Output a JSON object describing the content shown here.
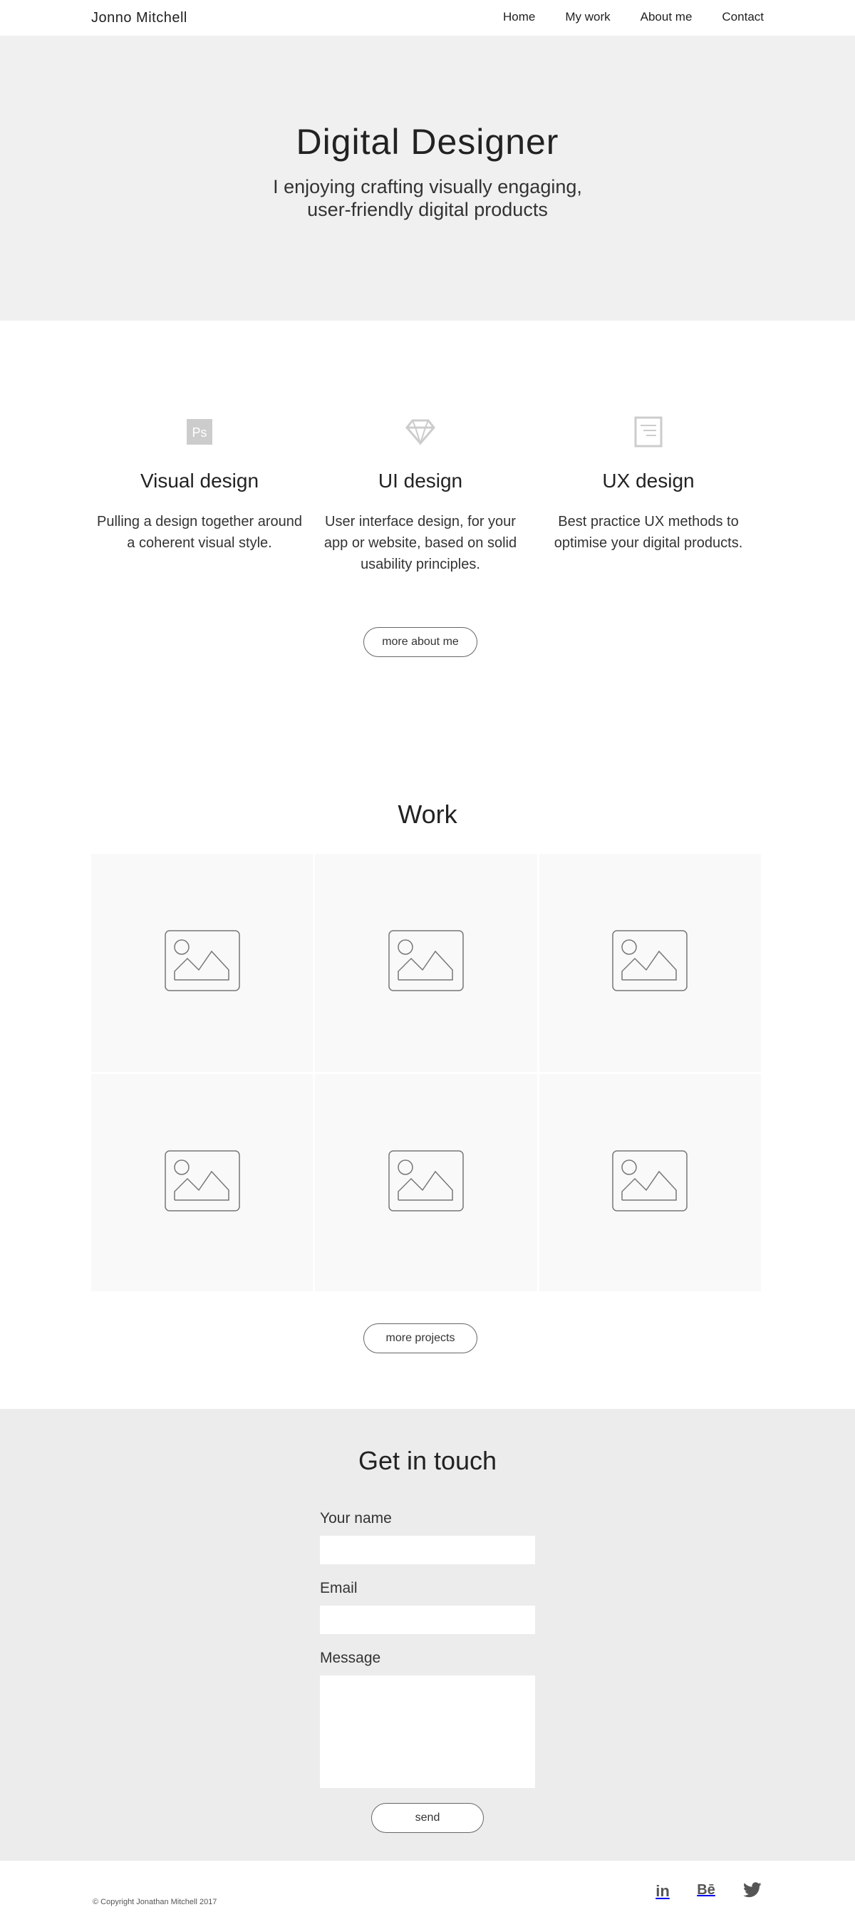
{
  "header": {
    "brand": "Jonno Mitchell",
    "nav": [
      "Home",
      "My work",
      "About me",
      "Contact"
    ]
  },
  "hero": {
    "title": "Digital Designer",
    "subtitle": "I enjoying crafting visually engaging, user-friendly digital products"
  },
  "services": {
    "items": [
      {
        "icon": "photoshop-icon",
        "title": "Visual design",
        "text": "Pulling a design together around a coherent visual style."
      },
      {
        "icon": "sketch-icon",
        "title": "UI design",
        "text": "User interface design, for your app or website, based on solid usability principles."
      },
      {
        "icon": "document-icon",
        "title": "UX design",
        "text": "Best practice UX methods to optimise your digital products."
      }
    ],
    "button": "more about me"
  },
  "work": {
    "title": "Work",
    "tiles": [
      "image-placeholder-icon",
      "image-placeholder-icon",
      "image-placeholder-icon",
      "image-placeholder-icon",
      "image-placeholder-icon",
      "image-placeholder-icon"
    ],
    "button": "more projects"
  },
  "contact": {
    "title": "Get in touch",
    "name_label": "Your name",
    "email_label": "Email",
    "message_label": "Message",
    "send": "send"
  },
  "footer": {
    "copyright": "© Copyright Jonathan Mitchell 2017",
    "social": [
      "linkedin-icon",
      "behance-icon",
      "twitter-icon"
    ],
    "linkedin_text": "in",
    "behance_text": "Bē"
  },
  "colors": {
    "hero_bg": "#f0f0f0",
    "contact_bg": "#ececec",
    "tile_bg": "#f9f9f9",
    "icon_gray": "#cccccc",
    "social_gray": "#555555"
  }
}
